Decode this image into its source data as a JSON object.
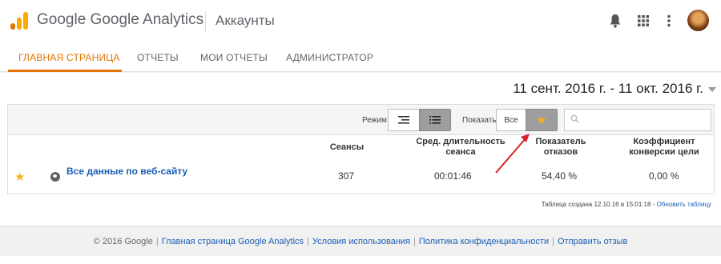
{
  "header": {
    "brand": "Google Google Analytics",
    "account": "Аккаунты",
    "icons": [
      "bell-icon",
      "apps-grid-icon",
      "more-vert-icon"
    ]
  },
  "nav": {
    "tabs": [
      {
        "label": "ГЛАВНАЯ СТРАНИЦА",
        "active": true
      },
      {
        "label": "ОТЧЕТЫ",
        "active": false
      },
      {
        "label": "МОИ ОТЧЕТЫ",
        "active": false
      },
      {
        "label": "АДМИНИСТРАТОР",
        "active": false
      }
    ]
  },
  "date_range": "11 сент. 2016 г. - 11 окт. 2016 г.",
  "toolbar": {
    "mode_label": "Режим",
    "show_label": "Показать",
    "show_all": "Все",
    "search_placeholder": ""
  },
  "table": {
    "columns": [
      "Сеансы",
      "Сред. длительность сеанса",
      "Показатель отказов",
      "Коэффициент конверсии цели"
    ],
    "rows": [
      {
        "name": "Все данные по веб-сайту",
        "sessions": "307",
        "avg_duration": "00:01:46",
        "bounce_rate": "54,40 %",
        "conversion_rate": "0,00 %"
      }
    ],
    "created_note": "Таблица создана 12.10.16 в 15:01:18 -",
    "refresh_link": "Обновить таблицу"
  },
  "footer": {
    "copyright": "© 2016 Google",
    "links": [
      "Главная страница Google Analytics",
      "Условия использования",
      "Политика конфиденциальности",
      "Отправить отзыв"
    ]
  },
  "colors": {
    "accent": "#e37400",
    "link": "#1a5fb4",
    "star": "#f5b21b",
    "annotation_arrow": "#d9202a"
  }
}
